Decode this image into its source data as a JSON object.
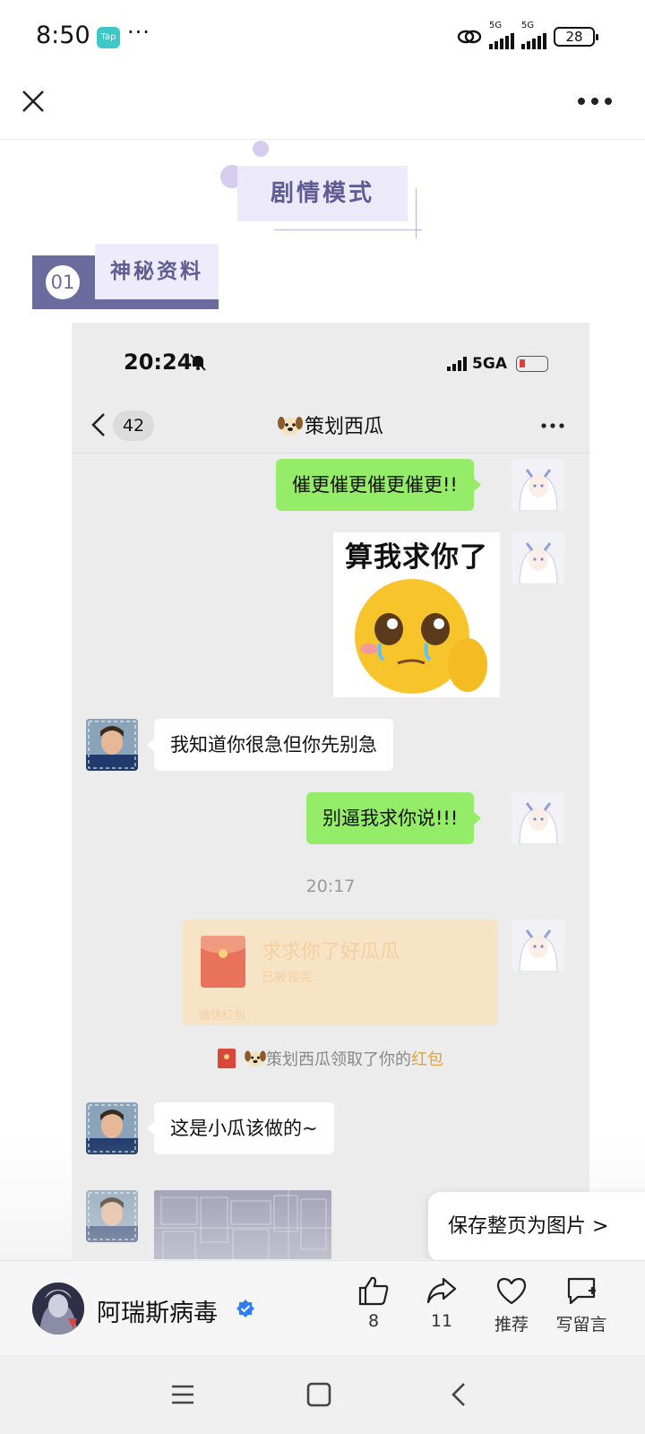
{
  "status_bar": {
    "time": "8:50",
    "app_badge": "Tap",
    "more": "···",
    "net1": "5G",
    "net2": "5G",
    "battery": "28"
  },
  "top_nav": {
    "close_icon": "close-icon",
    "more_icon": "more-icon"
  },
  "article": {
    "section_title": "剧情模式",
    "section_number": "01",
    "section_label": "神秘资料"
  },
  "chat_shot": {
    "status_time": "20:24",
    "status_net": "5GA",
    "back_count": "42",
    "chat_title": "策划西瓜",
    "messages": [
      {
        "from": "me",
        "text": "催更催更催更催更!!"
      },
      {
        "from": "me",
        "sticker_caption": "算我求你了"
      },
      {
        "from": "other",
        "text": "我知道你很急但你先别急"
      },
      {
        "from": "me",
        "text": "别逼我求你说!!!"
      }
    ],
    "timestamp": "20:17",
    "red_packet": {
      "title": "求求你了好瓜瓜",
      "status": "已被领完",
      "footer": "微信红包"
    },
    "system_msg": {
      "pre": "策划西瓜领取了你的",
      "highlight": "红包"
    },
    "last_message": "这是小瓜该做的~"
  },
  "save_button": "保存整页为图片 >",
  "action_bar": {
    "author": "阿瑞斯病毒",
    "like_count": "8",
    "share_count": "11",
    "recommend_label": "推荐",
    "comment_label": "写留言"
  },
  "colors": {
    "accent_purple": "#5f5c95",
    "wechat_green": "#95ec69",
    "red_packet": "#f7e3c6",
    "verified_blue": "#2f7cf6"
  }
}
